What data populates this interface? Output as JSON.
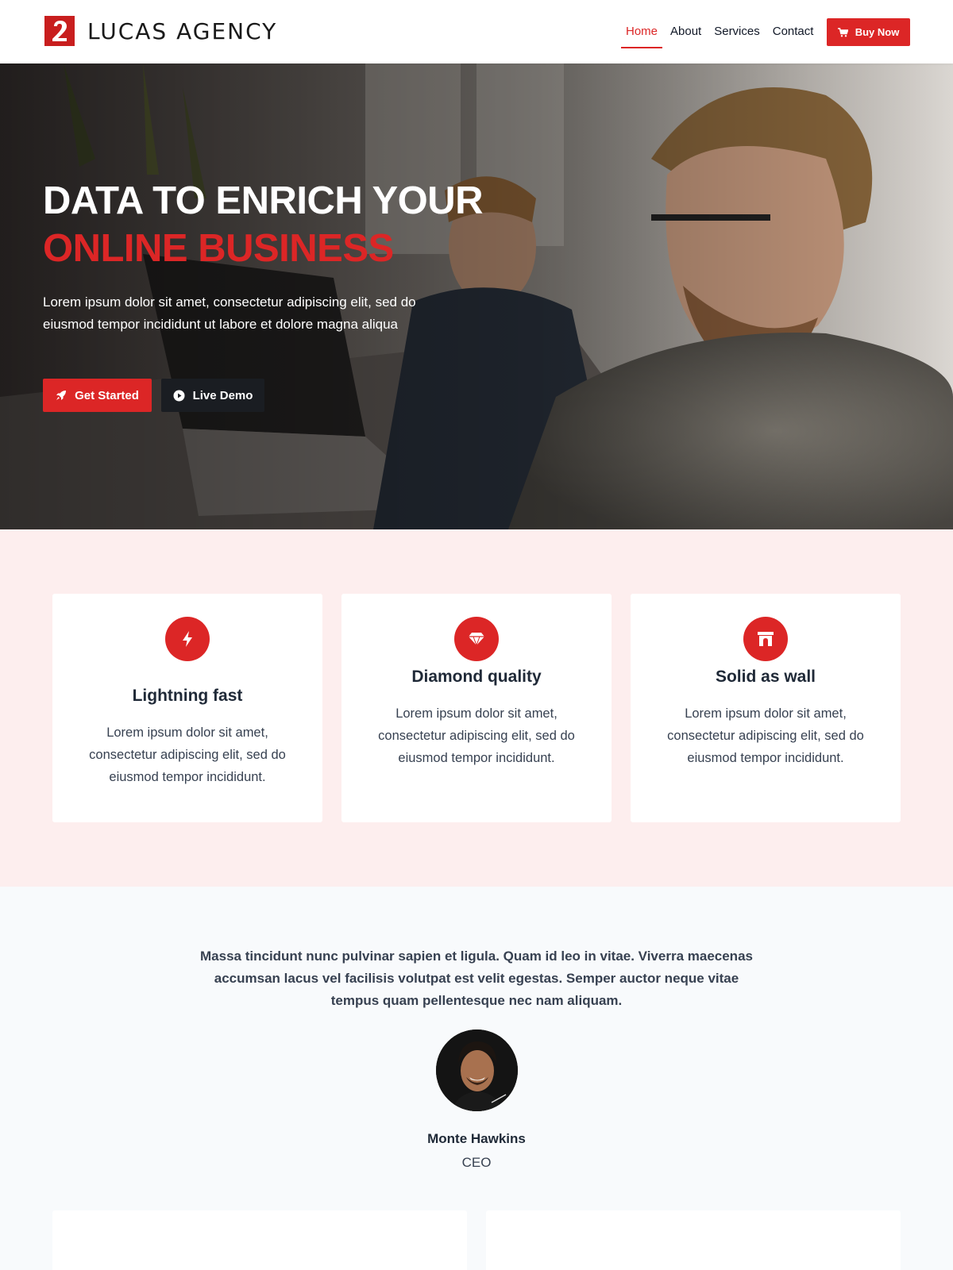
{
  "header": {
    "logo_text": "LUCAS AGENCY",
    "nav": [
      {
        "label": "Home",
        "active": true
      },
      {
        "label": "About",
        "active": false
      },
      {
        "label": "Services",
        "active": false
      },
      {
        "label": "Contact",
        "active": false
      }
    ],
    "buy_label": "Buy Now",
    "buy_icon": "cart-icon"
  },
  "hero": {
    "title_line1": "DATA TO ENRICH YOUR",
    "title_line2": "ONLINE BUSINESS",
    "description": "Lorem ipsum dolor sit amet, consectetur adipiscing elit, sed do eiusmod tempor incididunt ut labore et dolore magna aliqua",
    "primary_button": {
      "label": "Get Started",
      "icon": "rocket-icon"
    },
    "secondary_button": {
      "label": "Live Demo",
      "icon": "play-circle-icon"
    }
  },
  "features": [
    {
      "icon": "lightning-icon",
      "title": "Lightning fast",
      "text": "Lorem ipsum dolor sit amet, consectetur adipiscing elit, sed do eiusmod tempor incididunt."
    },
    {
      "icon": "diamond-icon",
      "title": "Diamond quality",
      "text": "Lorem ipsum dolor sit amet, consectetur adipiscing elit, sed do eiusmod tempor incididunt."
    },
    {
      "icon": "archway-icon",
      "title": "Solid as wall",
      "text": "Lorem ipsum dolor sit amet, consectetur adipiscing elit, sed do eiusmod tempor incididunt."
    }
  ],
  "testimonial": {
    "quote": "Massa tincidunt nunc pulvinar sapien et ligula. Quam id leo in vitae. Viverra maecenas accumsan lacus vel facilisis volutpat est velit egestas. Semper auctor neque vitae tempus quam pellentesque nec nam aliquam.",
    "name": "Monte Hawkins",
    "role": "CEO"
  },
  "colors": {
    "accent": "#dc2626",
    "features_bg": "#fdeeee",
    "dark_button": "#1a1d22"
  }
}
